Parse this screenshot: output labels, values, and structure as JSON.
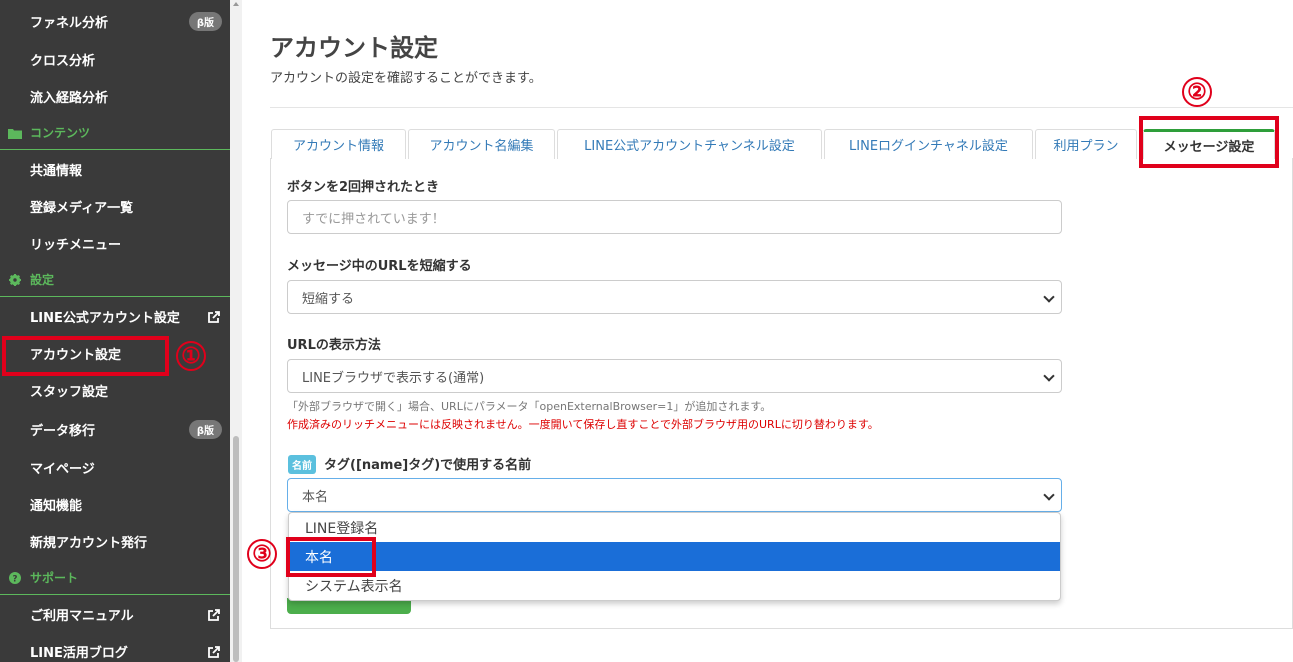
{
  "sidebar": {
    "items": [
      {
        "label": "ファネル分析",
        "badge": "β版"
      },
      {
        "label": "クロス分析"
      },
      {
        "label": "流入経路分析"
      },
      {
        "section": "コンテンツ",
        "icon": "folder-icon"
      },
      {
        "label": "共通情報"
      },
      {
        "label": "登録メディア一覧"
      },
      {
        "label": "リッチメニュー"
      },
      {
        "section": "設定",
        "icon": "gear-icon"
      },
      {
        "label": "LINE公式アカウント設定",
        "external": true
      },
      {
        "label": "アカウント設定"
      },
      {
        "label": "スタッフ設定"
      },
      {
        "label": "データ移行",
        "badge": "β版"
      },
      {
        "label": "マイページ"
      },
      {
        "label": "通知機能"
      },
      {
        "label": "新規アカウント発行"
      },
      {
        "section": "サポート",
        "icon": "question-circle-icon"
      },
      {
        "label": "ご利用マニュアル",
        "external": true
      },
      {
        "label": "LINE活用ブログ",
        "external": true
      }
    ]
  },
  "annotations": {
    "m1": "①",
    "m2": "②",
    "m3": "③"
  },
  "page": {
    "title": "アカウント設定",
    "subtitle": "アカウントの設定を確認することができます。"
  },
  "tabs": [
    {
      "label": "アカウント情報"
    },
    {
      "label": "アカウント名編集"
    },
    {
      "label": "LINE公式アカウントチャンネル設定"
    },
    {
      "label": "LINEログインチャネル設定"
    },
    {
      "label": "利用プラン"
    },
    {
      "label": "メッセージ設定",
      "active": true
    }
  ],
  "form": {
    "double_press": {
      "label": "ボタンを2回押されたとき",
      "placeholder": "すでに押されています！"
    },
    "shorten_url": {
      "label": "メッセージ中のURLを短縮する",
      "value": "短縮する"
    },
    "url_display": {
      "label": "URLの表示方法",
      "value": "LINEブラウザで表示する(通常)",
      "help": "「外部ブラウザで開く」場合、URLにパラメータ「openExternalBrowser=1」が追加されます。",
      "warning": "作成済みのリッチメニューには反映されません。一度開いて保存し直すことで外部ブラウザ用のURLに切り替わります。"
    },
    "name_tag": {
      "badge": "名前",
      "label": "タグ([name]タグ)で使用する名前",
      "value": "本名",
      "options": [
        "LINE登録名",
        "本名",
        "システム表示名"
      ],
      "selected_index": 1
    }
  },
  "colors": {
    "accent": "#5cb85c",
    "annotation": "#e0001b",
    "selected": "#1a6ed8",
    "sidebar": "#3a3a3a"
  }
}
